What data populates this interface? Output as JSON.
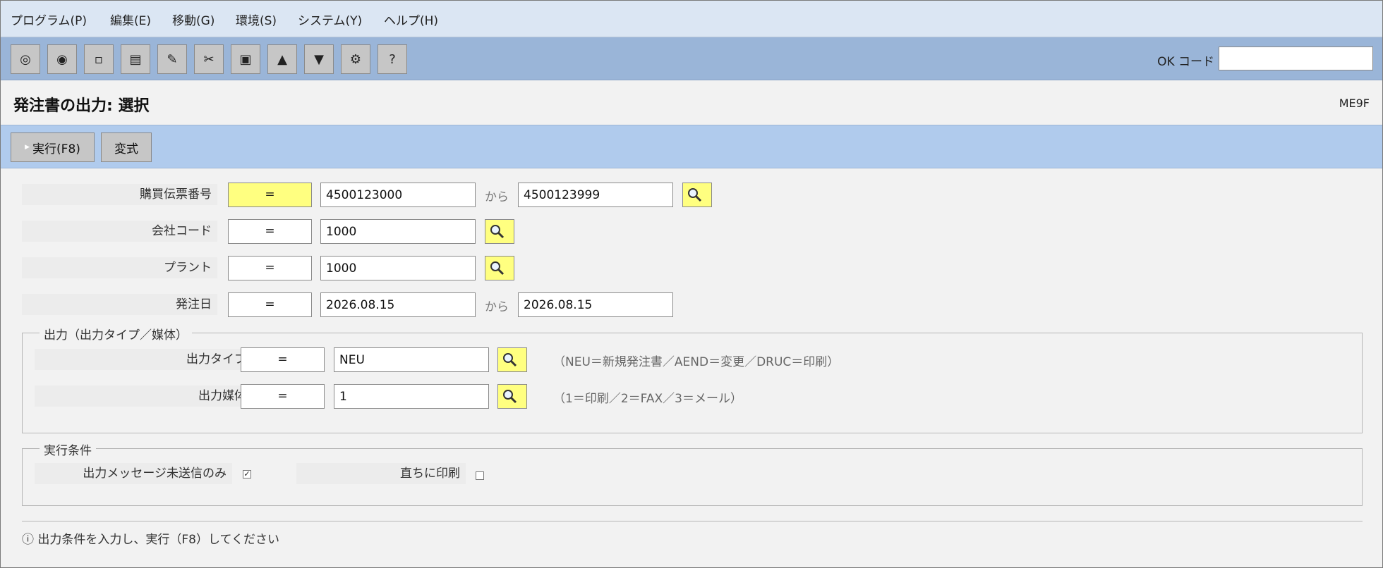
{
  "menubar": {
    "items": [
      {
        "label": "プログラム(P)"
      },
      {
        "label": "編集(E)"
      },
      {
        "label": "移動(G)"
      },
      {
        "label": "環境(S)"
      },
      {
        "label": "システム(Y)"
      },
      {
        "label": "ヘルプ(H)"
      }
    ]
  },
  "toolbar": {
    "buttons": [
      {
        "icon": "◎"
      },
      {
        "icon": "◉"
      },
      {
        "icon": "▫"
      },
      {
        "icon": "▤"
      },
      {
        "icon": "✎"
      },
      {
        "icon": "✂"
      },
      {
        "icon": "▣"
      },
      {
        "icon": "▲"
      },
      {
        "icon": "▼"
      },
      {
        "icon": "⚙"
      },
      {
        "icon": "?"
      }
    ],
    "ok_code_label": "OK コード",
    "ok_code_value": ""
  },
  "title": {
    "text": "発注書の出力: 選択",
    "transaction": "ME9F"
  },
  "appbar": {
    "execute_label": "実行(F8)",
    "variant_label": "変式"
  },
  "fields": {
    "po_number": {
      "label": "購買伝票番号",
      "op": "=",
      "from": "4500123000",
      "to_label": "から",
      "to": "4500123999"
    },
    "company_code": {
      "label": "会社コード",
      "op": "=",
      "value": "1000"
    },
    "plant": {
      "label": "プラント",
      "op": "=",
      "value": "1000"
    },
    "order_date": {
      "label": "発注日",
      "op": "=",
      "from": "2026.08.15",
      "to_label": "から",
      "to": "2026.08.15"
    }
  },
  "output_group": {
    "title": "出力（出力タイプ／媒体）",
    "output_type": {
      "label": "出力タイプ",
      "op": "=",
      "value": "NEU",
      "hint": "（NEU＝新規発注書／AEND＝変更／DRUC＝印刷）"
    },
    "output_medium": {
      "label": "出力媒体",
      "op": "=",
      "value": "1",
      "hint": "（1＝印刷／2＝FAX／3＝メール）"
    }
  },
  "exec_group": {
    "title": "実行条件",
    "unsent_only": {
      "label": "出力メッセージ未送信のみ",
      "checked": true
    },
    "print_immediately": {
      "label": "直ちに印刷",
      "checked": false
    }
  },
  "status": {
    "icon": "ⓘ",
    "text": "出力条件を入力し、実行（F8）してください"
  },
  "colors": {
    "menubar": "#dbe6f3",
    "toolbar": "#9ab5d8",
    "appbar": "#b0cbed",
    "search_button": "#ffff80",
    "background": "#f2f2f2"
  }
}
